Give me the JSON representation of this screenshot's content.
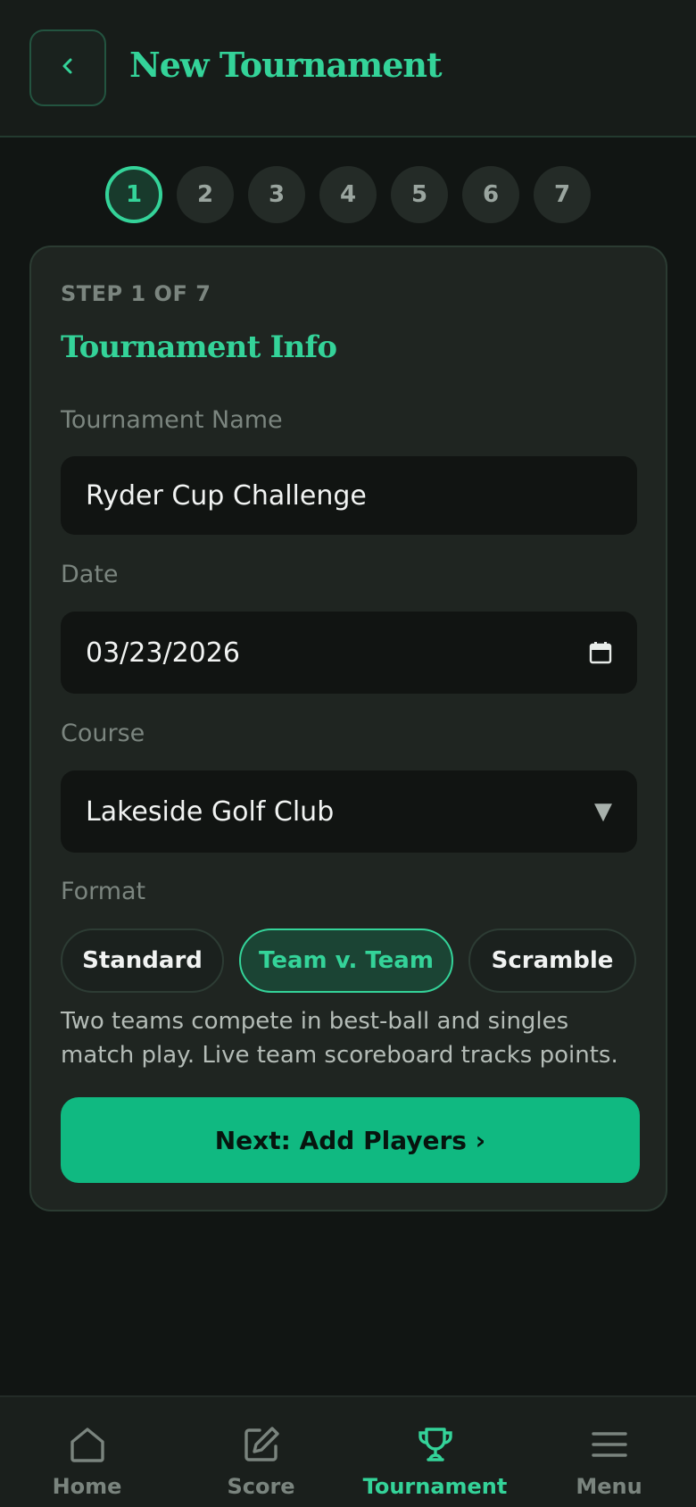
{
  "header": {
    "title": "New Tournament",
    "back_icon": "chevron-left-icon"
  },
  "stepper": {
    "current": 1,
    "steps": [
      "1",
      "2",
      "3",
      "4",
      "5",
      "6",
      "7"
    ]
  },
  "card": {
    "step_label": "STEP 1 OF 7",
    "title": "Tournament Info",
    "tournament_name": {
      "label": "Tournament Name",
      "value": "Ryder Cup Challenge"
    },
    "date": {
      "label": "Date",
      "value": "03/23/2026",
      "icon": "calendar-icon"
    },
    "course": {
      "label": "Course",
      "selected": "Lakeside Golf Club",
      "icon": "dropdown-arrow-icon"
    },
    "format": {
      "label": "Format",
      "options": [
        "Standard",
        "Team v. Team",
        "Scramble"
      ],
      "selected": "Team v. Team",
      "description": "Two teams compete in best-ball and singles match play. Live team scoreboard tracks points."
    },
    "next_button": "Next: Add Players ›"
  },
  "bottom_nav": {
    "items": [
      {
        "label": "Home",
        "icon": "home-icon"
      },
      {
        "label": "Score",
        "icon": "edit-icon"
      },
      {
        "label": "Tournament",
        "icon": "trophy-icon",
        "active": true
      },
      {
        "label": "Menu",
        "icon": "menu-icon"
      }
    ]
  },
  "colors": {
    "accent": "#34d399",
    "button": "#10b981",
    "background": "#111513",
    "card": "#1f2521"
  }
}
